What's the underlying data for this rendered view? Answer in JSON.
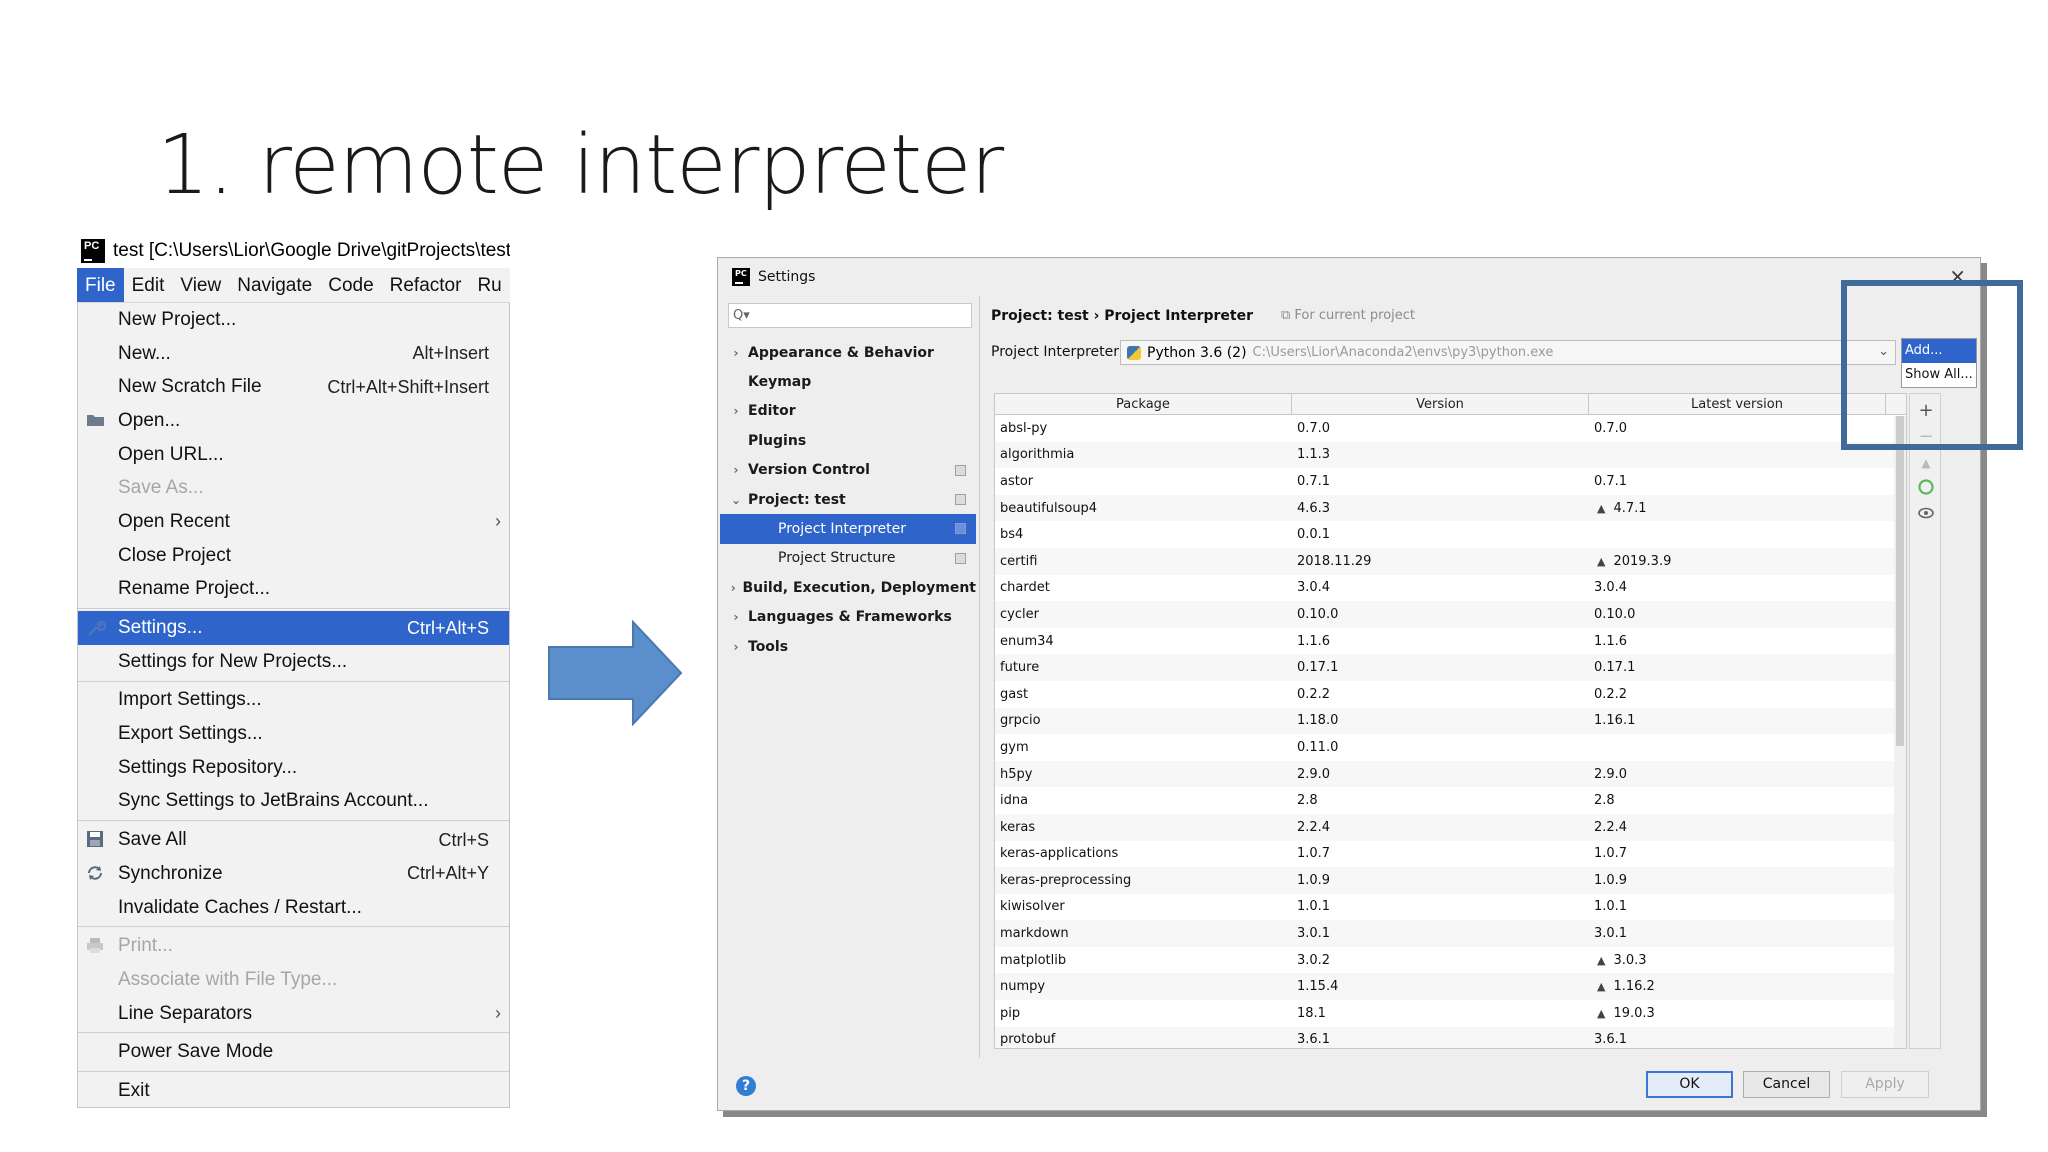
{
  "slide": {
    "title": "1. remote interpreter"
  },
  "ide": {
    "window_title": "test [C:\\Users\\Lior\\Google Drive\\gitProjects\\test",
    "menubar": [
      {
        "label": "File",
        "active": true
      },
      {
        "label": "Edit"
      },
      {
        "label": "View"
      },
      {
        "label": "Navigate"
      },
      {
        "label": "Code"
      },
      {
        "label": "Refactor"
      },
      {
        "label": "Ru"
      }
    ],
    "file_menu": [
      {
        "label": "New Project...",
        "shortcut": ""
      },
      {
        "label": "New...",
        "shortcut": "Alt+Insert"
      },
      {
        "label": "New Scratch File",
        "shortcut": "Ctrl+Alt+Shift+Insert"
      },
      {
        "label": "Open...",
        "shortcut": "",
        "icon": "folder-icon"
      },
      {
        "label": "Open URL...",
        "shortcut": ""
      },
      {
        "label": "Save As...",
        "shortcut": "",
        "disabled": true
      },
      {
        "label": "Open Recent",
        "shortcut": "",
        "submenu": "›"
      },
      {
        "label": "Close Project",
        "shortcut": ""
      },
      {
        "label": "Rename Project...",
        "shortcut": ""
      },
      {
        "sep": true
      },
      {
        "label": "Settings...",
        "shortcut": "Ctrl+Alt+S",
        "selected": true,
        "icon": "wrench-icon"
      },
      {
        "label": "Settings for New Projects...",
        "shortcut": ""
      },
      {
        "sep": true
      },
      {
        "label": "Import Settings...",
        "shortcut": ""
      },
      {
        "label": "Export Settings...",
        "shortcut": ""
      },
      {
        "label": "Settings Repository...",
        "shortcut": ""
      },
      {
        "label": "Sync Settings to JetBrains Account...",
        "shortcut": ""
      },
      {
        "sep": true
      },
      {
        "label": "Save All",
        "shortcut": "Ctrl+S",
        "icon": "save-icon"
      },
      {
        "label": "Synchronize",
        "shortcut": "Ctrl+Alt+Y",
        "icon": "sync-icon"
      },
      {
        "label": "Invalidate Caches / Restart...",
        "shortcut": ""
      },
      {
        "sep": true
      },
      {
        "label": "Print...",
        "shortcut": "",
        "disabled": true,
        "icon": "print-icon"
      },
      {
        "label": "Associate with File Type...",
        "shortcut": "",
        "disabled": true
      },
      {
        "label": "Line Separators",
        "shortcut": "",
        "submenu": "›"
      },
      {
        "sep": true
      },
      {
        "label": "Power Save Mode",
        "shortcut": ""
      },
      {
        "sep": true
      },
      {
        "label": "Exit",
        "shortcut": ""
      }
    ]
  },
  "settings": {
    "window_title": "Settings",
    "close_glyph": "×",
    "search_placeholder": "Q▾",
    "tree": [
      {
        "label": "Appearance & Behavior",
        "arrow": "›",
        "level": 0
      },
      {
        "label": "Keymap",
        "arrow": "",
        "level": 0
      },
      {
        "label": "Editor",
        "arrow": "›",
        "level": 0
      },
      {
        "label": "Plugins",
        "arrow": "",
        "level": 0
      },
      {
        "label": "Version Control",
        "arrow": "›",
        "level": 0,
        "proj": true
      },
      {
        "label": "Project: test",
        "arrow": "⌄",
        "level": 0,
        "proj": true
      },
      {
        "label": "Project Interpreter",
        "arrow": "",
        "level": 1,
        "proj": true,
        "selected": true
      },
      {
        "label": "Project Structure",
        "arrow": "",
        "level": 1,
        "proj": true
      },
      {
        "label": "Build, Execution, Deployment",
        "arrow": "›",
        "level": 0
      },
      {
        "label": "Languages & Frameworks",
        "arrow": "›",
        "level": 0
      },
      {
        "label": "Tools",
        "arrow": "›",
        "level": 0
      }
    ],
    "breadcrumb": "Project: test  ›  Project Interpreter",
    "breadcrumb_note": "For current project",
    "interpreter_label": "Project Interpreter:",
    "interpreter_name": "Python 3.6 (2)",
    "interpreter_path": "C:\\Users\\Lior\\Anaconda2\\envs\\py3\\python.exe",
    "popup": [
      "Add...",
      "Show All..."
    ],
    "columns": [
      "Package",
      "Version",
      "Latest version"
    ],
    "packages": [
      [
        "absl-py",
        "0.7.0",
        "0.7.0",
        false
      ],
      [
        "algorithmia",
        "1.1.3",
        "",
        false
      ],
      [
        "astor",
        "0.7.1",
        "0.7.1",
        false
      ],
      [
        "beautifulsoup4",
        "4.6.3",
        "4.7.1",
        true
      ],
      [
        "bs4",
        "0.0.1",
        "",
        false
      ],
      [
        "certifi",
        "2018.11.29",
        "2019.3.9",
        true
      ],
      [
        "chardet",
        "3.0.4",
        "3.0.4",
        false
      ],
      [
        "cycler",
        "0.10.0",
        "0.10.0",
        false
      ],
      [
        "enum34",
        "1.1.6",
        "1.1.6",
        false
      ],
      [
        "future",
        "0.17.1",
        "0.17.1",
        false
      ],
      [
        "gast",
        "0.2.2",
        "0.2.2",
        false
      ],
      [
        "grpcio",
        "1.18.0",
        "1.16.1",
        false
      ],
      [
        "gym",
        "0.11.0",
        "",
        false
      ],
      [
        "h5py",
        "2.9.0",
        "2.9.0",
        false
      ],
      [
        "idna",
        "2.8",
        "2.8",
        false
      ],
      [
        "keras",
        "2.2.4",
        "2.2.4",
        false
      ],
      [
        "keras-applications",
        "1.0.7",
        "1.0.7",
        false
      ],
      [
        "keras-preprocessing",
        "1.0.9",
        "1.0.9",
        false
      ],
      [
        "kiwisolver",
        "1.0.1",
        "1.0.1",
        false
      ],
      [
        "markdown",
        "3.0.1",
        "3.0.1",
        false
      ],
      [
        "matplotlib",
        "3.0.2",
        "3.0.3",
        true
      ],
      [
        "numpy",
        "1.15.4",
        "1.16.2",
        true
      ],
      [
        "pip",
        "18.1",
        "19.0.3",
        true
      ],
      [
        "protobuf",
        "3.6.1",
        "3.6.1",
        false
      ]
    ],
    "buttons": {
      "ok": "OK",
      "cancel": "Cancel",
      "apply": "Apply",
      "help": "?"
    },
    "tools": {
      "add": "+",
      "remove": "−",
      "up": "▲"
    }
  },
  "colors": {
    "accent": "#2f65ca",
    "arrow": "#5b8fcb",
    "highlight": "#3f6a9a"
  }
}
